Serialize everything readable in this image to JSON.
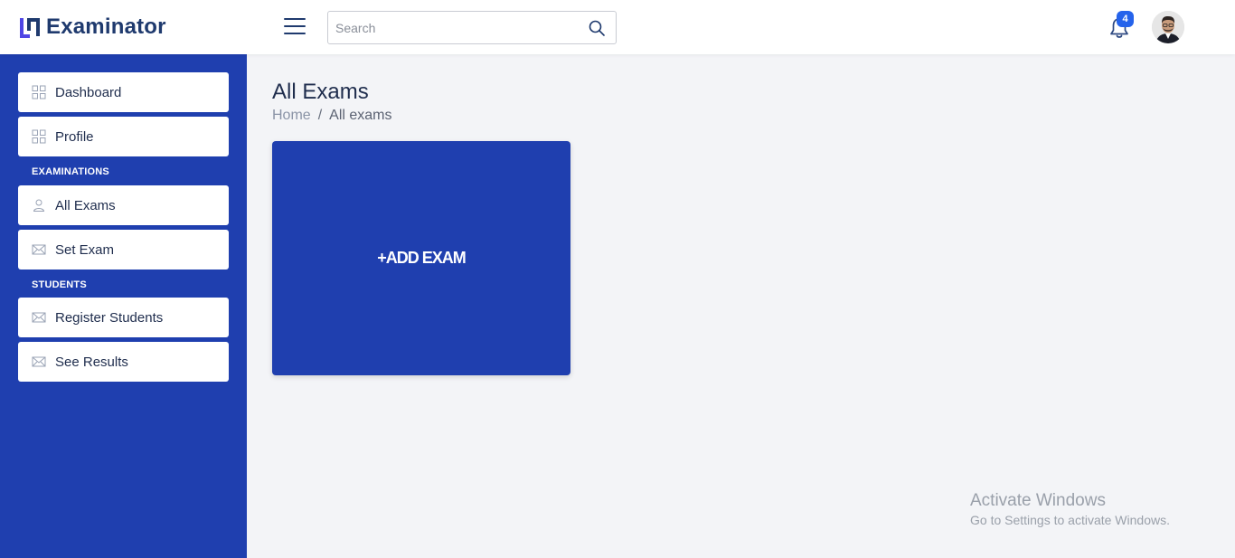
{
  "app": {
    "name": "Examinator",
    "brand_color": "#1f3faf",
    "accent_color": "#2563eb"
  },
  "header": {
    "search": {
      "placeholder": "Search",
      "value": ""
    },
    "notifications": {
      "count": "4"
    }
  },
  "sidebar": {
    "items": [
      {
        "label": "Dashboard",
        "icon": "grid-icon"
      },
      {
        "label": "Profile",
        "icon": "grid-icon"
      }
    ],
    "sections": [
      {
        "title": "EXAMINATIONS",
        "items": [
          {
            "label": "All Exams",
            "icon": "user-icon"
          },
          {
            "label": "Set Exam",
            "icon": "mail-icon"
          }
        ]
      },
      {
        "title": "STUDENTS",
        "items": [
          {
            "label": "Register Students",
            "icon": "mail-icon"
          },
          {
            "label": "See Results",
            "icon": "mail-icon"
          }
        ]
      }
    ]
  },
  "main": {
    "title": "All Exams",
    "breadcrumb": {
      "home": "Home",
      "separator": "/",
      "current": "All exams"
    },
    "add_card_label": "+ADD EXAM"
  },
  "watermark": {
    "line1": "Activate Windows",
    "line2": "Go to Settings to activate Windows."
  }
}
